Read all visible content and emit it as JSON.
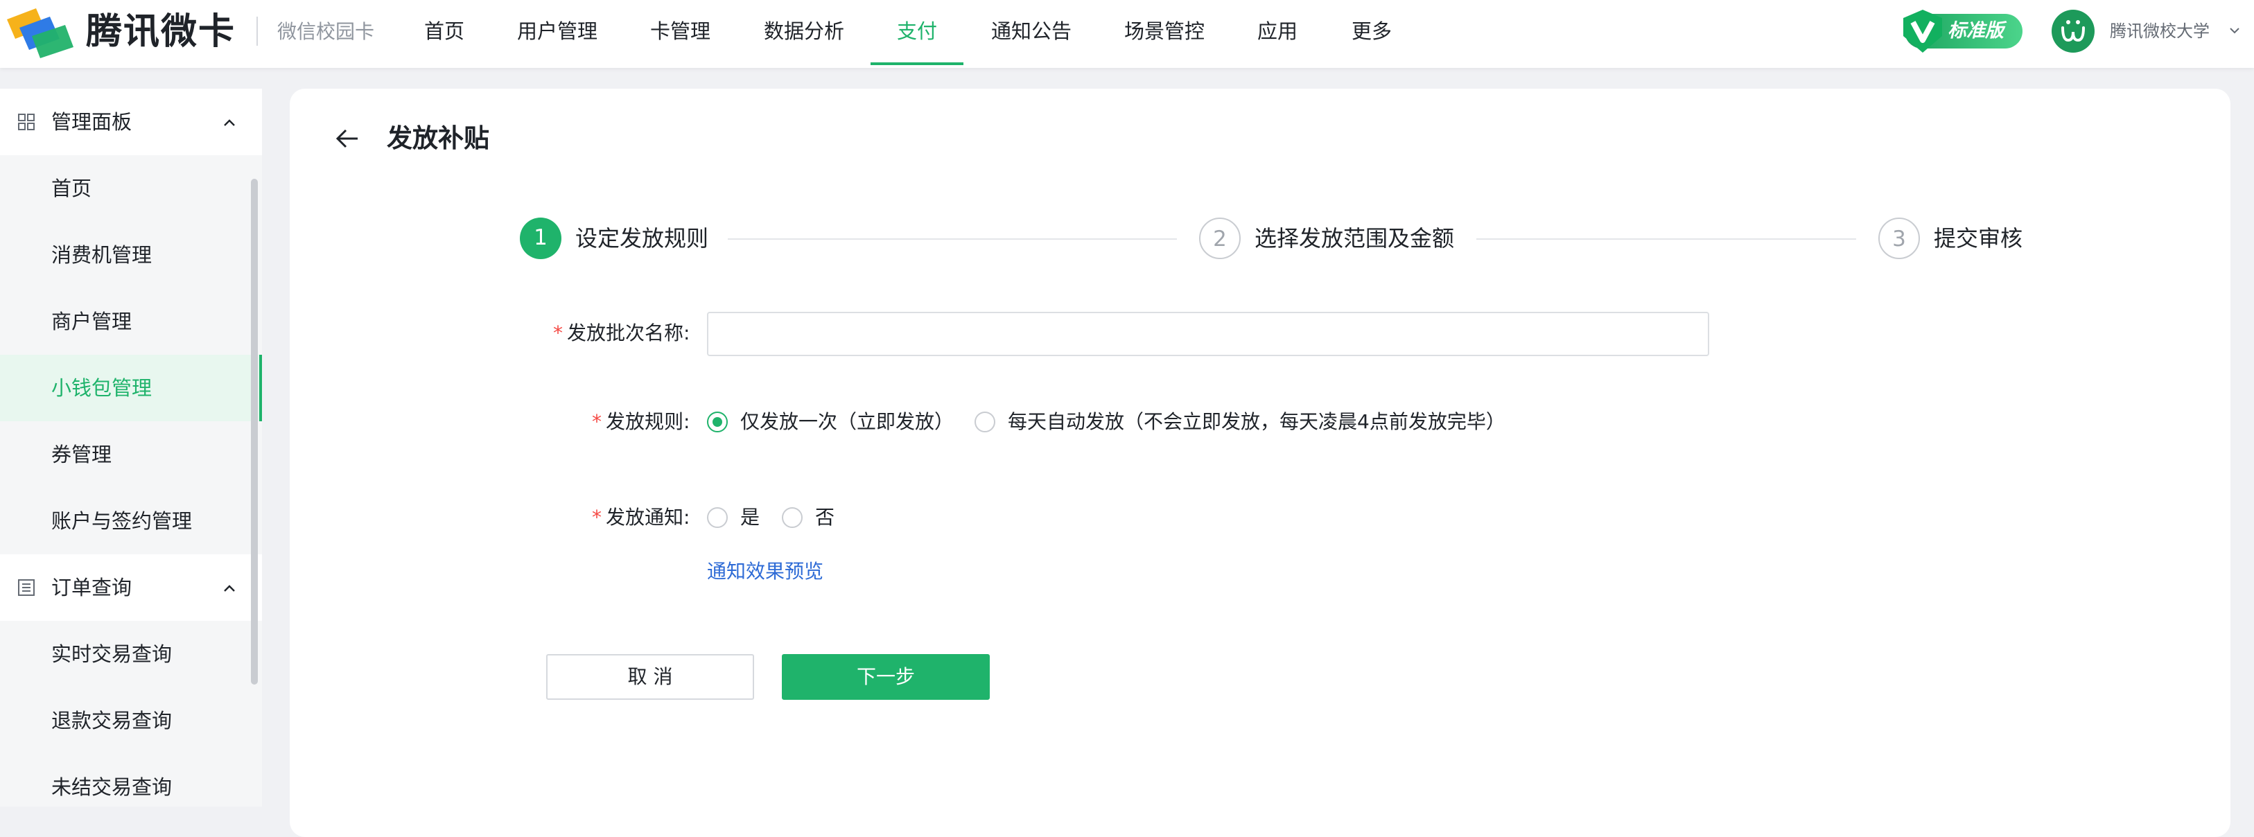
{
  "header": {
    "brand": "腾讯微卡",
    "subbrand": "微信校园卡",
    "nav": [
      "首页",
      "用户管理",
      "卡管理",
      "数据分析",
      "支付",
      "通知公告",
      "场景管控",
      "应用",
      "更多"
    ],
    "active_nav": "支付",
    "edition_badge": "标准版",
    "school_name": "腾讯微校大学",
    "accent_color": "#1fb36b"
  },
  "sidebar": {
    "groups": [
      {
        "label": "管理面板",
        "icon": "grid-icon",
        "expanded": true,
        "items": [
          "首页",
          "消费机管理",
          "商户管理",
          "小钱包管理",
          "券管理",
          "账户与签约管理"
        ]
      },
      {
        "label": "订单查询",
        "icon": "list-icon",
        "expanded": true,
        "items": [
          "实时交易查询",
          "退款交易查询",
          "未结交易查询"
        ]
      }
    ],
    "active_item": "小钱包管理"
  },
  "page": {
    "title": "发放补贴",
    "steps": [
      {
        "number": "1",
        "label": "设定发放规则",
        "state": "active"
      },
      {
        "number": "2",
        "label": "选择发放范围及金额",
        "state": "todo"
      },
      {
        "number": "3",
        "label": "提交审核",
        "state": "todo"
      }
    ],
    "form": {
      "batch_name": {
        "label": "发放批次名称:",
        "value": "",
        "placeholder": ""
      },
      "rule": {
        "label": "发放规则:",
        "options": [
          "仅发放一次（立即发放）",
          "每天自动发放（不会立即发放，每天凌晨4点前发放完毕）"
        ],
        "selected": 0
      },
      "notify": {
        "label": "发放通知:",
        "options": [
          "是",
          "否"
        ],
        "selected": null
      },
      "preview_link": "通知效果预览"
    },
    "buttons": {
      "cancel": "取 消",
      "next": "下一步"
    }
  }
}
